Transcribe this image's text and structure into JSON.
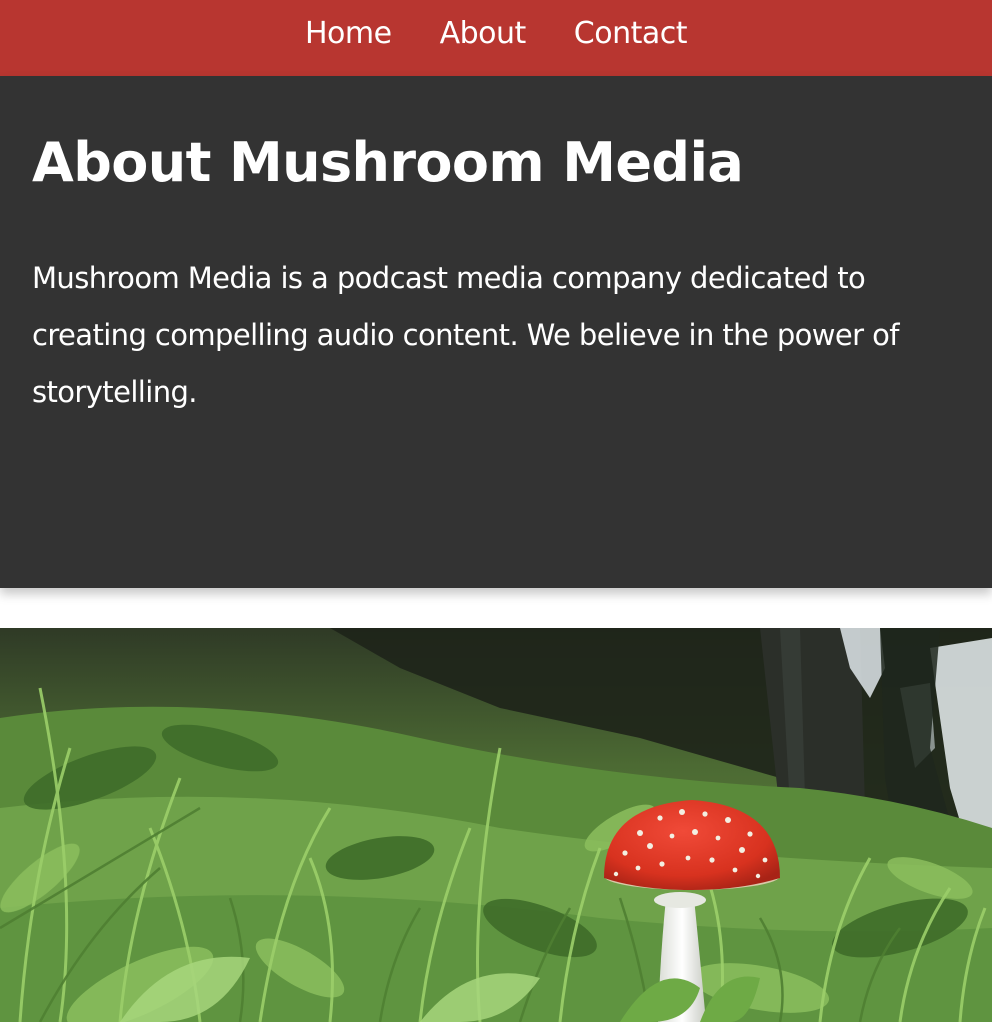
{
  "nav": {
    "items": [
      {
        "label": "Home"
      },
      {
        "label": "About"
      },
      {
        "label": "Contact"
      }
    ]
  },
  "about": {
    "heading": "About Mushroom Media",
    "body": "Mushroom Media is a podcast media company dedicated to creating compelling audio content. We believe in the power of storytelling."
  },
  "photo": {
    "subject": "red-fly-agaric-mushroom-in-grass"
  },
  "colors": {
    "nav_bg": "#b83630",
    "section_bg": "#333333",
    "text": "#ffffff"
  }
}
